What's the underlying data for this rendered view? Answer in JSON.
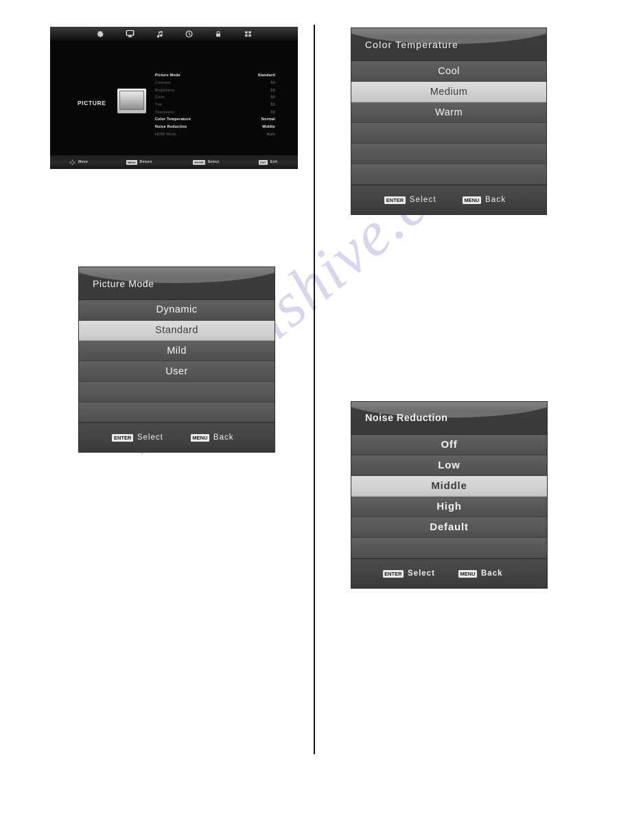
{
  "page": {
    "watermark": "manualshive.com"
  },
  "osd_main": {
    "screen_label": "PICTURE",
    "top_icons": [
      {
        "name": "settings-icon",
        "glyph": "gear",
        "active": false
      },
      {
        "name": "picture-icon",
        "glyph": "monitor",
        "active": true
      },
      {
        "name": "sound-icon",
        "glyph": "note",
        "active": false
      },
      {
        "name": "time-icon",
        "glyph": "clock",
        "active": false
      },
      {
        "name": "lock-icon",
        "glyph": "lock",
        "active": false
      },
      {
        "name": "option-icon",
        "glyph": "grid",
        "active": false
      }
    ],
    "settings": [
      {
        "label": "Picture Mode",
        "value": "Standard",
        "enabled": true
      },
      {
        "label": "Contrast",
        "value": "50",
        "enabled": false
      },
      {
        "label": "Brightness",
        "value": "50",
        "enabled": false
      },
      {
        "label": "Color",
        "value": "50",
        "enabled": false
      },
      {
        "label": "Tint",
        "value": "50",
        "enabled": false
      },
      {
        "label": "Sharpness",
        "value": "50",
        "enabled": false
      },
      {
        "label": "Color Temperature",
        "value": "Normal",
        "enabled": true
      },
      {
        "label": "Noise Reduction",
        "value": "Middle",
        "enabled": true
      },
      {
        "label": "HDMI Mode",
        "value": "Auto",
        "enabled": false
      }
    ],
    "hints": [
      {
        "key": "",
        "icon": "dpad-icon",
        "label": "Move"
      },
      {
        "key": "MENU",
        "icon": "",
        "label": "Return"
      },
      {
        "key": "ENTER",
        "icon": "",
        "label": "Select"
      },
      {
        "key": "EXIT",
        "icon": "",
        "label": "Exit"
      }
    ]
  },
  "dialogs": {
    "picture_mode": {
      "title": "Picture Mode",
      "options": [
        "Dynamic",
        "Standard",
        "Mild",
        "User",
        "",
        ""
      ],
      "selected_index": 1,
      "footer": [
        {
          "key": "ENTER",
          "label": "Select"
        },
        {
          "key": "MENU",
          "label": "Back"
        }
      ]
    },
    "color_temperature": {
      "title": "Color Temperature",
      "options": [
        "Cool",
        "Medium",
        "Warm",
        "",
        "",
        ""
      ],
      "selected_index": 1,
      "footer": [
        {
          "key": "ENTER",
          "label": "Select"
        },
        {
          "key": "MENU",
          "label": "Back"
        }
      ]
    },
    "noise_reduction": {
      "title": "Noise Reduction",
      "options": [
        "Off",
        "Low",
        "Middle",
        "High",
        "Default",
        ""
      ],
      "selected_index": 2,
      "footer": [
        {
          "key": "ENTER",
          "label": "Select"
        },
        {
          "key": "MENU",
          "label": "Back"
        }
      ]
    }
  },
  "colors": {
    "osd_background": "#070707",
    "dialog_row": "#585858",
    "dialog_row_selected": "#d2d2d2",
    "dialog_title": "#3a3a3a",
    "dialog_footer": "#434343",
    "watermark": "#b9b6e2"
  }
}
